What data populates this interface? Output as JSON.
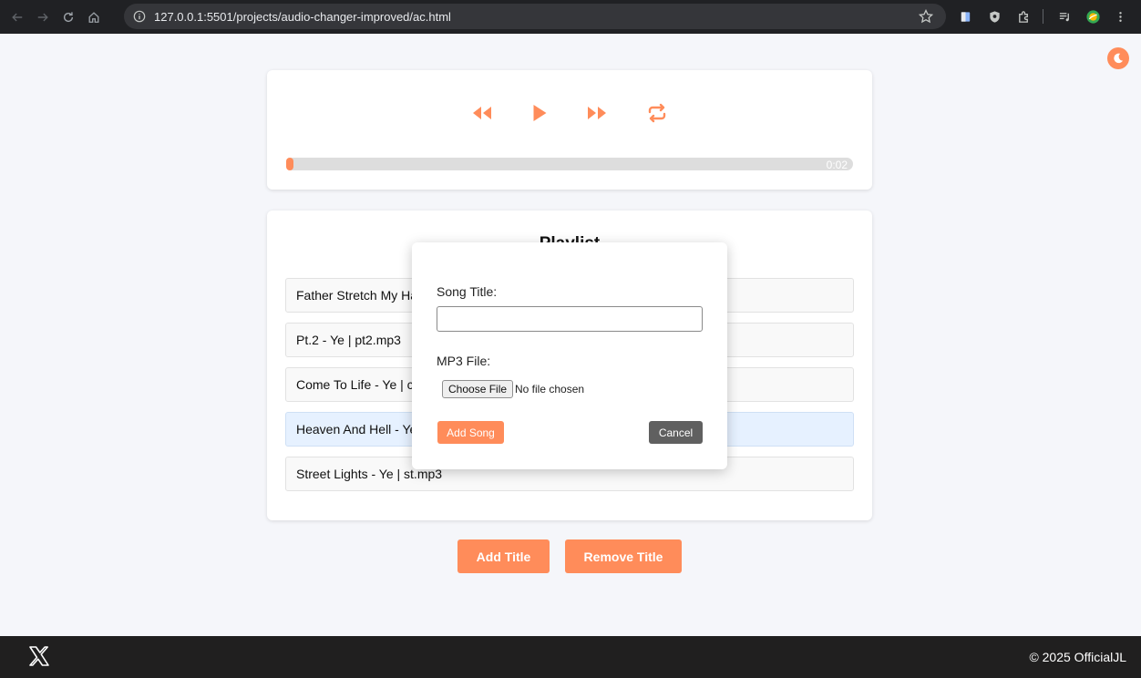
{
  "browser": {
    "url": "127.0.0.1:5501/projects/audio-changer-improved/ac.html"
  },
  "player": {
    "time": "0:02",
    "progress_fraction": 0.01
  },
  "playlist": {
    "title": "Playlist",
    "songs": [
      "Father Stretch My Ha",
      "Pt.2 - Ye | pt2.mp3",
      "Come To Life - Ye | c",
      "Heaven And Hell - Ye",
      "Street Lights - Ye | st.mp3"
    ],
    "active_index": 3
  },
  "actions": {
    "add_title": "Add Title",
    "remove_title": "Remove Title"
  },
  "modal": {
    "song_title_label": "Song Title:",
    "song_title_value": "",
    "mp3_label": "MP3 File:",
    "choose_file": "Choose File",
    "file_status": "No file chosen",
    "add_song": "Add Song",
    "cancel": "Cancel"
  },
  "footer": {
    "copyright": "© 2025 OfficialJL"
  },
  "colors": {
    "accent": "#ff8c5a",
    "active_row": "#e6f1ff",
    "footer_bg": "#201f1f"
  },
  "icons": [
    "back-icon",
    "forward-icon",
    "reload-icon",
    "home-icon",
    "info-icon",
    "star-icon",
    "extension-icon",
    "shield-icon",
    "puzzle-icon",
    "media-icon",
    "profile-icon",
    "kebab-menu-icon",
    "moon-icon",
    "rewind-icon",
    "play-icon",
    "fast-forward-icon",
    "repeat-icon",
    "x-logo-icon"
  ]
}
